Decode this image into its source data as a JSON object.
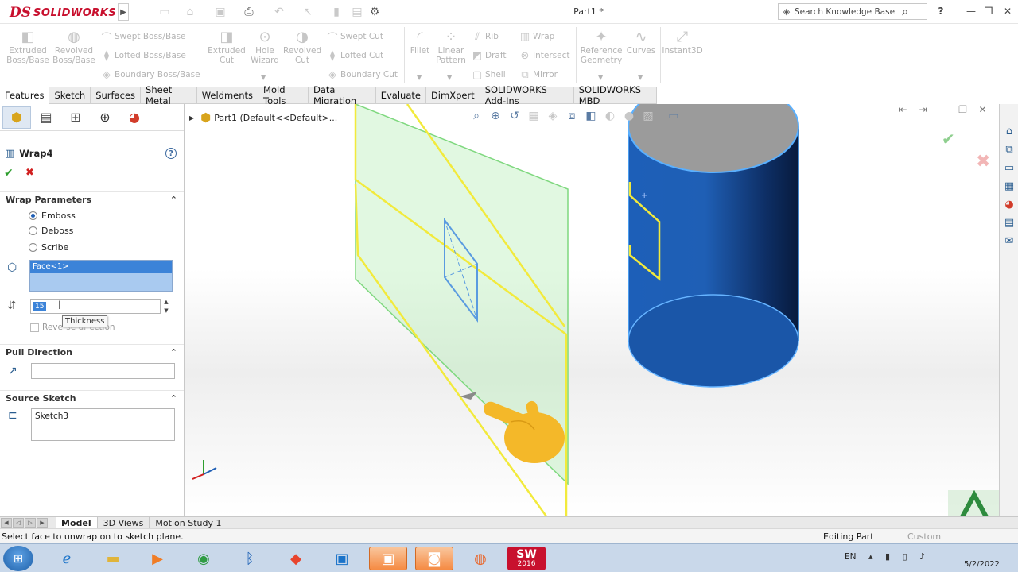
{
  "titlebar": {
    "brand": "SOLIDWORKS",
    "brand_prefix": "DS",
    "doc_title": "Part1 *",
    "search_placeholder": "Search Knowledge Base",
    "help_glyph": "?"
  },
  "command_manager": {
    "big": [
      {
        "label": "Extruded\nBoss/Base"
      },
      {
        "label": "Revolved\nBoss/Base"
      },
      {
        "label": "Extruded\nCut"
      },
      {
        "label": "Hole\nWizard"
      },
      {
        "label": "Revolved\nCut"
      },
      {
        "label": "Fillet"
      },
      {
        "label": "Linear\nPattern"
      },
      {
        "label": "Reference\nGeometry"
      },
      {
        "label": "Curves"
      },
      {
        "label": "Instant3D"
      }
    ],
    "small": [
      "Swept Boss/Base",
      "Lofted Boss/Base",
      "Boundary Boss/Base",
      "Swept Cut",
      "Lofted Cut",
      "Boundary Cut",
      "Rib",
      "Draft",
      "Shell",
      "Wrap",
      "Intersect",
      "Mirror"
    ]
  },
  "tabs": [
    "Features",
    "Sketch",
    "Surfaces",
    "Sheet Metal",
    "Weldments",
    "Mold Tools",
    "Data Migration",
    "Evaluate",
    "DimXpert",
    "SOLIDWORKS Add-Ins",
    "SOLIDWORKS MBD"
  ],
  "active_tab": "Features",
  "property_manager": {
    "title": "Wrap4",
    "help": "?",
    "wrap_parameters": {
      "heading": "Wrap Parameters",
      "options": [
        "Emboss",
        "Deboss",
        "Scribe"
      ],
      "selected": "Emboss",
      "face_selection": "Face<1>",
      "thickness_value": "15",
      "thickness_tooltip": "Thickness",
      "reverse_direction": "Reverse direction"
    },
    "pull_direction": {
      "heading": "Pull Direction",
      "value": ""
    },
    "source_sketch": {
      "heading": "Source Sketch",
      "value": "Sketch3"
    }
  },
  "feature_tree": {
    "root": "Part1  (Default<<Default>..."
  },
  "bottom_tabs": [
    "Model",
    "3D Views",
    "Motion Study 1"
  ],
  "active_bottom_tab": "Model",
  "status": {
    "message": "Select face to unwrap on to sketch plane.",
    "mode": "Editing Part",
    "units": "Custom"
  },
  "taskbar": {
    "language": "EN",
    "date": "5/2/2022",
    "pinned_badge": "2016"
  },
  "colors": {
    "brand_red": "#c8102e",
    "cylinder_blue": "#1f5fb5",
    "plane_green": "#7fd87f",
    "sketch_yellow": "#f2ea3c",
    "selection_blue": "#3c83d8",
    "hand_yellow": "#f4b829"
  }
}
